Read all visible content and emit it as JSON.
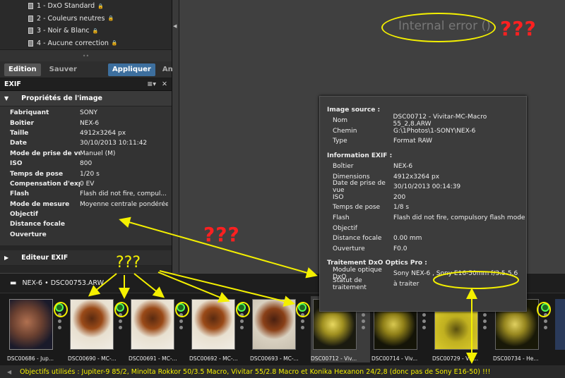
{
  "presets": [
    {
      "label": "1 - DxO Standard"
    },
    {
      "label": "2 - Couleurs neutres"
    },
    {
      "label": "3 - Noir & Blanc"
    },
    {
      "label": "4 - Aucune correction"
    }
  ],
  "buttons": {
    "edition": "Edition",
    "sauver": "Sauver",
    "appliquer": "Appliquer",
    "annuler": "Annuler"
  },
  "exif_panel": {
    "title": "EXIF",
    "section": "Propriétés de l'image",
    "rows": [
      {
        "k": "Fabriquant",
        "v": "SONY"
      },
      {
        "k": "Boîtier",
        "v": "NEX-6"
      },
      {
        "k": "Taille",
        "v": "4912x3264 px"
      },
      {
        "k": "Date",
        "v": "30/10/2013 10:11:42"
      },
      {
        "k": "Mode de prise de vue",
        "v": "Manuel (M)"
      },
      {
        "k": "ISO",
        "v": "800"
      },
      {
        "k": "Temps de pose",
        "v": "1/20 s"
      },
      {
        "k": "Compensation d'expo.",
        "v": "0 EV"
      },
      {
        "k": "Flash",
        "v": "Flash did not fire, compul..."
      },
      {
        "k": "Mode de mesure",
        "v": "Moyenne centrale pondérée"
      },
      {
        "k": "Objectif",
        "v": ""
      },
      {
        "k": "Distance focale",
        "v": ""
      },
      {
        "k": "Ouverture",
        "v": ""
      }
    ],
    "editor": "Editeur EXIF"
  },
  "internal_error": "Internal error ()",
  "marks": {
    "red": "???",
    "yellow": "???"
  },
  "tooltip": {
    "source_title": "Image source :",
    "source": [
      {
        "k": "Nom",
        "v": "DSC00712 - Vivitar-MC-Macro 55_2,8.ARW"
      },
      {
        "k": "Chemin",
        "v": "G:\\1Photos\\1-SONY\\NEX-6"
      },
      {
        "k": "Type",
        "v": "Format RAW"
      }
    ],
    "exif_title": "Information EXIF :",
    "exif": [
      {
        "k": "Boîtier",
        "v": "NEX-6"
      },
      {
        "k": "Dimensions",
        "v": "4912x3264  px"
      },
      {
        "k": "Date de prise de vue",
        "v": "30/10/2013 00:14:39"
      },
      {
        "k": "ISO",
        "v": "200"
      },
      {
        "k": "Temps de pose",
        "v": "1/8 s"
      },
      {
        "k": "Flash",
        "v": "Flash did not fire, compulsory flash mode"
      },
      {
        "k": "Objectif",
        "v": ""
      },
      {
        "k": "Distance focale",
        "v": "0.00  mm"
      },
      {
        "k": "Ouverture",
        "v": "F0.0"
      }
    ],
    "dxo_title": "Traitement DxO Optics Pro :",
    "dxo": [
      {
        "k": "Module optique DxO",
        "v": "Sony NEX-6 , Sony E16-50mm f/3.5-5.6"
      },
      {
        "k": "Statut de traitement",
        "v": "à traiter"
      }
    ]
  },
  "filmstrip": {
    "path": "NEX-6 • DSC00753.ARW",
    "thumbs": [
      {
        "cap": "DSC00686 - Jup..."
      },
      {
        "cap": "DSC00690 - MC-..."
      },
      {
        "cap": "DSC00691 - MC-..."
      },
      {
        "cap": "DSC00692 - MC-..."
      },
      {
        "cap": "DSC00693 - MC-..."
      },
      {
        "cap": "DSC00712 - Viv..."
      },
      {
        "cap": "DSC00714 - Viv..."
      },
      {
        "cap": "DSC00729 - Viv..."
      },
      {
        "cap": "DSC00734 - He..."
      }
    ]
  },
  "bottom_note": "Objectifs utilisés : Jupiter-9 85/2, Minolta Rokkor 50/3.5 Macro, Vivitar 55/2.8 Macro et Konika Hexanon  24/2,8 (donc pas de Sony E16-50) !!!"
}
